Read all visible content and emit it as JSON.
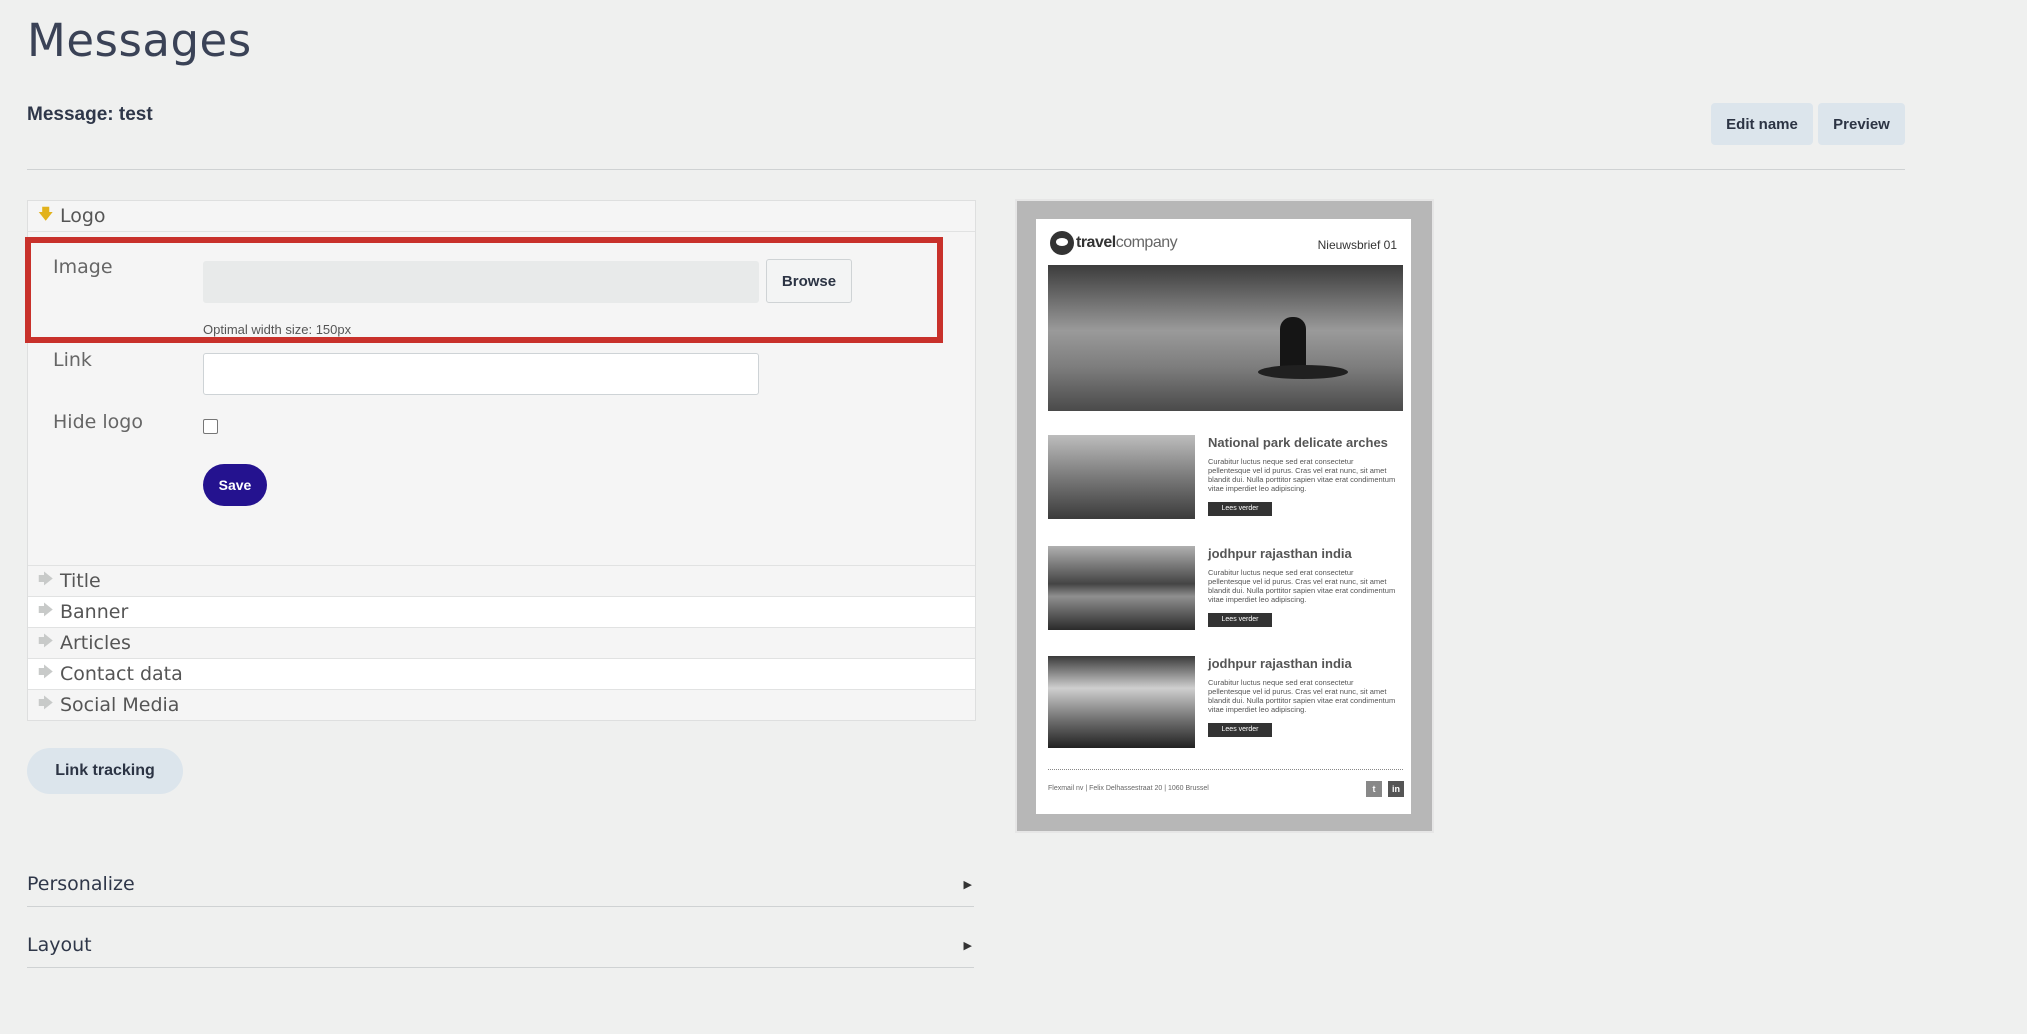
{
  "page": {
    "title": "Messages",
    "message_label": "Message: test"
  },
  "toolbar": {
    "edit_name": "Edit name",
    "preview": "Preview"
  },
  "accordion": {
    "logo": {
      "title": "Logo",
      "image_label": "Image",
      "browse": "Browse",
      "hint": "Optimal width size: 150px",
      "link_label": "Link",
      "link_value": "",
      "hide_logo_label": "Hide logo",
      "hide_logo_checked": false,
      "save": "Save"
    },
    "sections": [
      "Title",
      "Banner",
      "Articles",
      "Contact data",
      "Social Media"
    ]
  },
  "link_tracking": "Link tracking",
  "panels": {
    "personalize": "Personalize",
    "layout": "Layout"
  },
  "newsletter": {
    "logo_bold": "travel",
    "logo_light": "company",
    "issue": "Nieuwsbrief 01",
    "articles": [
      {
        "title": "National park delicate arches",
        "text": "Curabitur luctus neque sed erat consectetur pellentesque vel id purus. Cras vel erat nunc, sit amet blandit dui. Nulla porttitor sapien vitae erat condimentum vitae imperdiet leo adipiscing.",
        "button": "Lees verder"
      },
      {
        "title": "jodhpur rajasthan india",
        "text": "Curabitur luctus neque sed erat consectetur pellentesque vel id purus. Cras vel erat nunc, sit amet blandit dui. Nulla porttitor sapien vitae erat condimentum vitae imperdiet leo adipiscing.",
        "button": "Lees verder"
      },
      {
        "title": "jodhpur rajasthan india",
        "text": "Curabitur luctus neque sed erat consectetur pellentesque vel id purus. Cras vel erat nunc, sit amet blandit dui. Nulla porttitor sapien vitae erat condimentum vitae imperdiet leo adipiscing.",
        "button": "Lees verder"
      }
    ],
    "footer": "Flexmail nv  |  Felix Delhassestraat 20  |  1060 Brussel",
    "social": [
      "t",
      "in"
    ]
  },
  "colors": {
    "accent": "#24128f",
    "highlight": "#c8312b",
    "button_bg": "#dce5ec"
  }
}
